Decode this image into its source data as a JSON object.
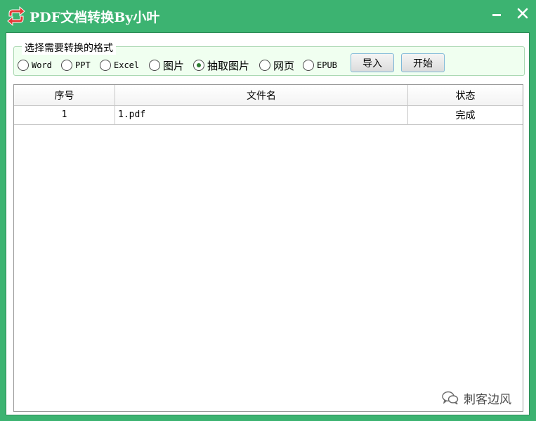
{
  "window": {
    "title": "PDF文档转换By小叶"
  },
  "format_group": {
    "legend": "选择需要转换的格式",
    "options": [
      {
        "label": "Word",
        "selected": false
      },
      {
        "label": "PPT",
        "selected": false
      },
      {
        "label": "Excel",
        "selected": false
      },
      {
        "label": "图片",
        "selected": false
      },
      {
        "label": "抽取图片",
        "selected": true
      },
      {
        "label": "网页",
        "selected": false
      },
      {
        "label": "EPUB",
        "selected": false
      }
    ],
    "import_label": "导入",
    "start_label": "开始"
  },
  "table": {
    "columns": [
      "序号",
      "文件名",
      "状态"
    ],
    "rows": [
      {
        "index": "1",
        "filename": "1.pdf",
        "status": "完成"
      }
    ]
  },
  "watermark": {
    "text": "刺客边风"
  },
  "colors": {
    "window_green": "#3cb371",
    "icon_red": "#e53935",
    "selected_dot": "#2e7d32"
  }
}
